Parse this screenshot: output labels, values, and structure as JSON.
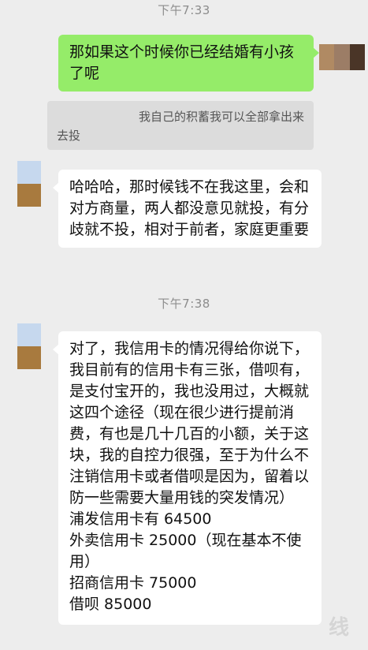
{
  "timestamps": [
    "下午7:33",
    "下午7:38"
  ],
  "messages": {
    "m1": "那如果这个时候你已经结婚有小孩了呢",
    "quote": "我自己的积蓄我可以全部拿出来去投",
    "m2": "哈哈哈，那时候钱不在我这里，会和对方商量，两人都没意见就投，有分歧就不投，相对于前者，家庭更重要",
    "m3": "对了，我信用卡的情况得给你说下，我目前有的信用卡有三张，借呗有，是支付宝开的，我也没用过，大概就这四个途径（现在很少进行提前消费，有也是几十几百的小额，关于这块，我的自控力很强，至于为什么不注销信用卡或者借呗是因为，留着以防一些需要大量用钱的突发情况）\n浦发信用卡有 64500\n外卖信用卡 25000（现在基本不使用）\n招商信用卡 75000\n借呗 85000"
  },
  "watermark": "线",
  "colors": {
    "background": "#ededed",
    "bubble_self": "#95ec69",
    "bubble_other": "#ffffff",
    "quote_bg": "#dcdcdc",
    "timestamp_text": "#8c8c8c"
  }
}
